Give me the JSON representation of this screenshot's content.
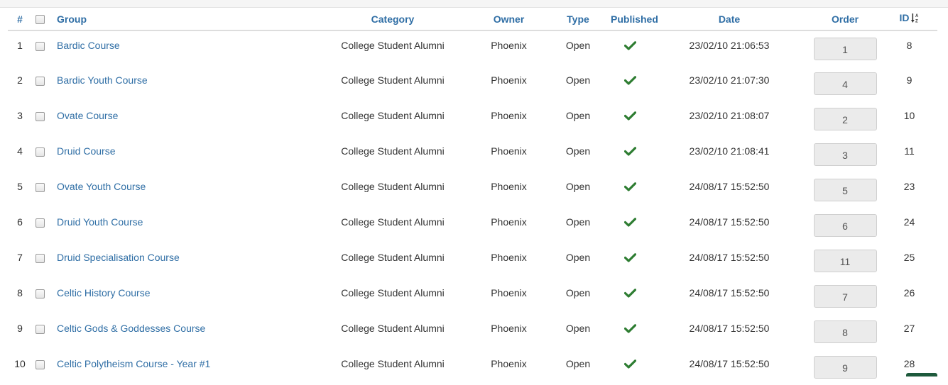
{
  "columns": {
    "num": "#",
    "group": "Group",
    "category": "Category",
    "owner": "Owner",
    "type": "Type",
    "published": "Published",
    "date": "Date",
    "order": "Order",
    "id": "ID"
  },
  "icons": {
    "published": "checkmark-icon",
    "sort": "sort-ascending-icon"
  },
  "colors": {
    "link": "#2f6ea5",
    "check": "#2e7d32"
  },
  "rows": [
    {
      "num": "1",
      "group": "Bardic Course",
      "category": "College Student Alumni",
      "owner": "Phoenix",
      "type": "Open",
      "date": "23/02/10 21:06:53",
      "order": "1",
      "id": "8"
    },
    {
      "num": "2",
      "group": "Bardic Youth Course",
      "category": "College Student Alumni",
      "owner": "Phoenix",
      "type": "Open",
      "date": "23/02/10 21:07:30",
      "order": "4",
      "id": "9"
    },
    {
      "num": "3",
      "group": "Ovate Course",
      "category": "College Student Alumni",
      "owner": "Phoenix",
      "type": "Open",
      "date": "23/02/10 21:08:07",
      "order": "2",
      "id": "10"
    },
    {
      "num": "4",
      "group": "Druid Course",
      "category": "College Student Alumni",
      "owner": "Phoenix",
      "type": "Open",
      "date": "23/02/10 21:08:41",
      "order": "3",
      "id": "11"
    },
    {
      "num": "5",
      "group": "Ovate Youth Course",
      "category": "College Student Alumni",
      "owner": "Phoenix",
      "type": "Open",
      "date": "24/08/17 15:52:50",
      "order": "5",
      "id": "23"
    },
    {
      "num": "6",
      "group": "Druid Youth Course",
      "category": "College Student Alumni",
      "owner": "Phoenix",
      "type": "Open",
      "date": "24/08/17 15:52:50",
      "order": "6",
      "id": "24"
    },
    {
      "num": "7",
      "group": "Druid Specialisation Course",
      "category": "College Student Alumni",
      "owner": "Phoenix",
      "type": "Open",
      "date": "24/08/17 15:52:50",
      "order": "11",
      "id": "25"
    },
    {
      "num": "8",
      "group": "Celtic History Course",
      "category": "College Student Alumni",
      "owner": "Phoenix",
      "type": "Open",
      "date": "24/08/17 15:52:50",
      "order": "7",
      "id": "26"
    },
    {
      "num": "9",
      "group": "Celtic Gods & Goddesses Course",
      "category": "College Student Alumni",
      "owner": "Phoenix",
      "type": "Open",
      "date": "24/08/17 15:52:50",
      "order": "8",
      "id": "27"
    },
    {
      "num": "10",
      "group": "Celtic Polytheism Course - Year #1",
      "category": "College Student Alumni",
      "owner": "Phoenix",
      "type": "Open",
      "date": "24/08/17 15:52:50",
      "order": "9",
      "id": "28"
    }
  ]
}
